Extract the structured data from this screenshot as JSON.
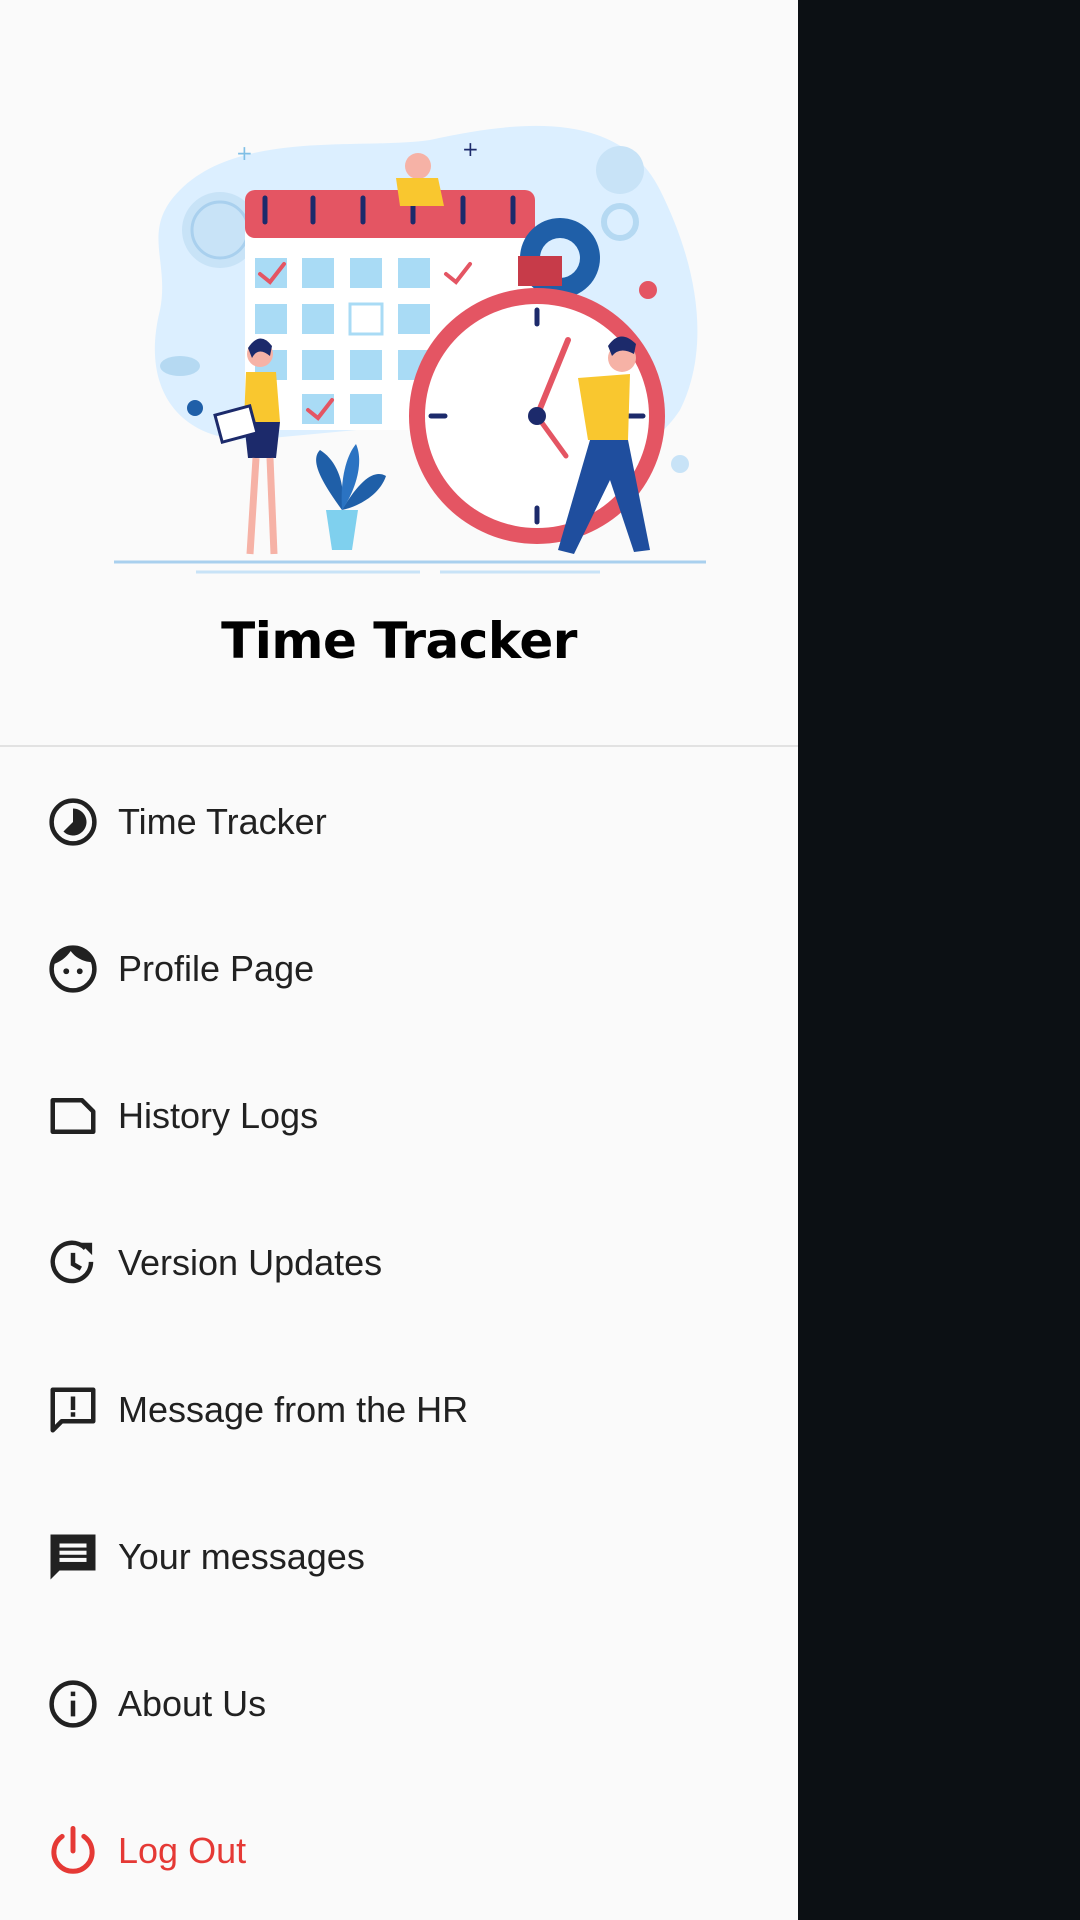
{
  "app": {
    "title": "Time Tracker"
  },
  "theme": {
    "drawer_bg": "#fafafa",
    "scrim": "#0c1014",
    "text": "#212121",
    "logout_color": "#e53935"
  },
  "menu": {
    "items": [
      {
        "label": "Time Tracker",
        "icon": "timelapse-icon"
      },
      {
        "label": "Profile Page",
        "icon": "face-icon"
      },
      {
        "label": "History Logs",
        "icon": "label-outline-icon"
      },
      {
        "label": "Version Updates",
        "icon": "update-icon"
      },
      {
        "label": "Message from the HR",
        "icon": "feedback-icon"
      },
      {
        "label": "Your messages",
        "icon": "message-icon"
      },
      {
        "label": "About Us",
        "icon": "info-icon"
      },
      {
        "label": "Log Out",
        "icon": "power-icon"
      }
    ]
  }
}
